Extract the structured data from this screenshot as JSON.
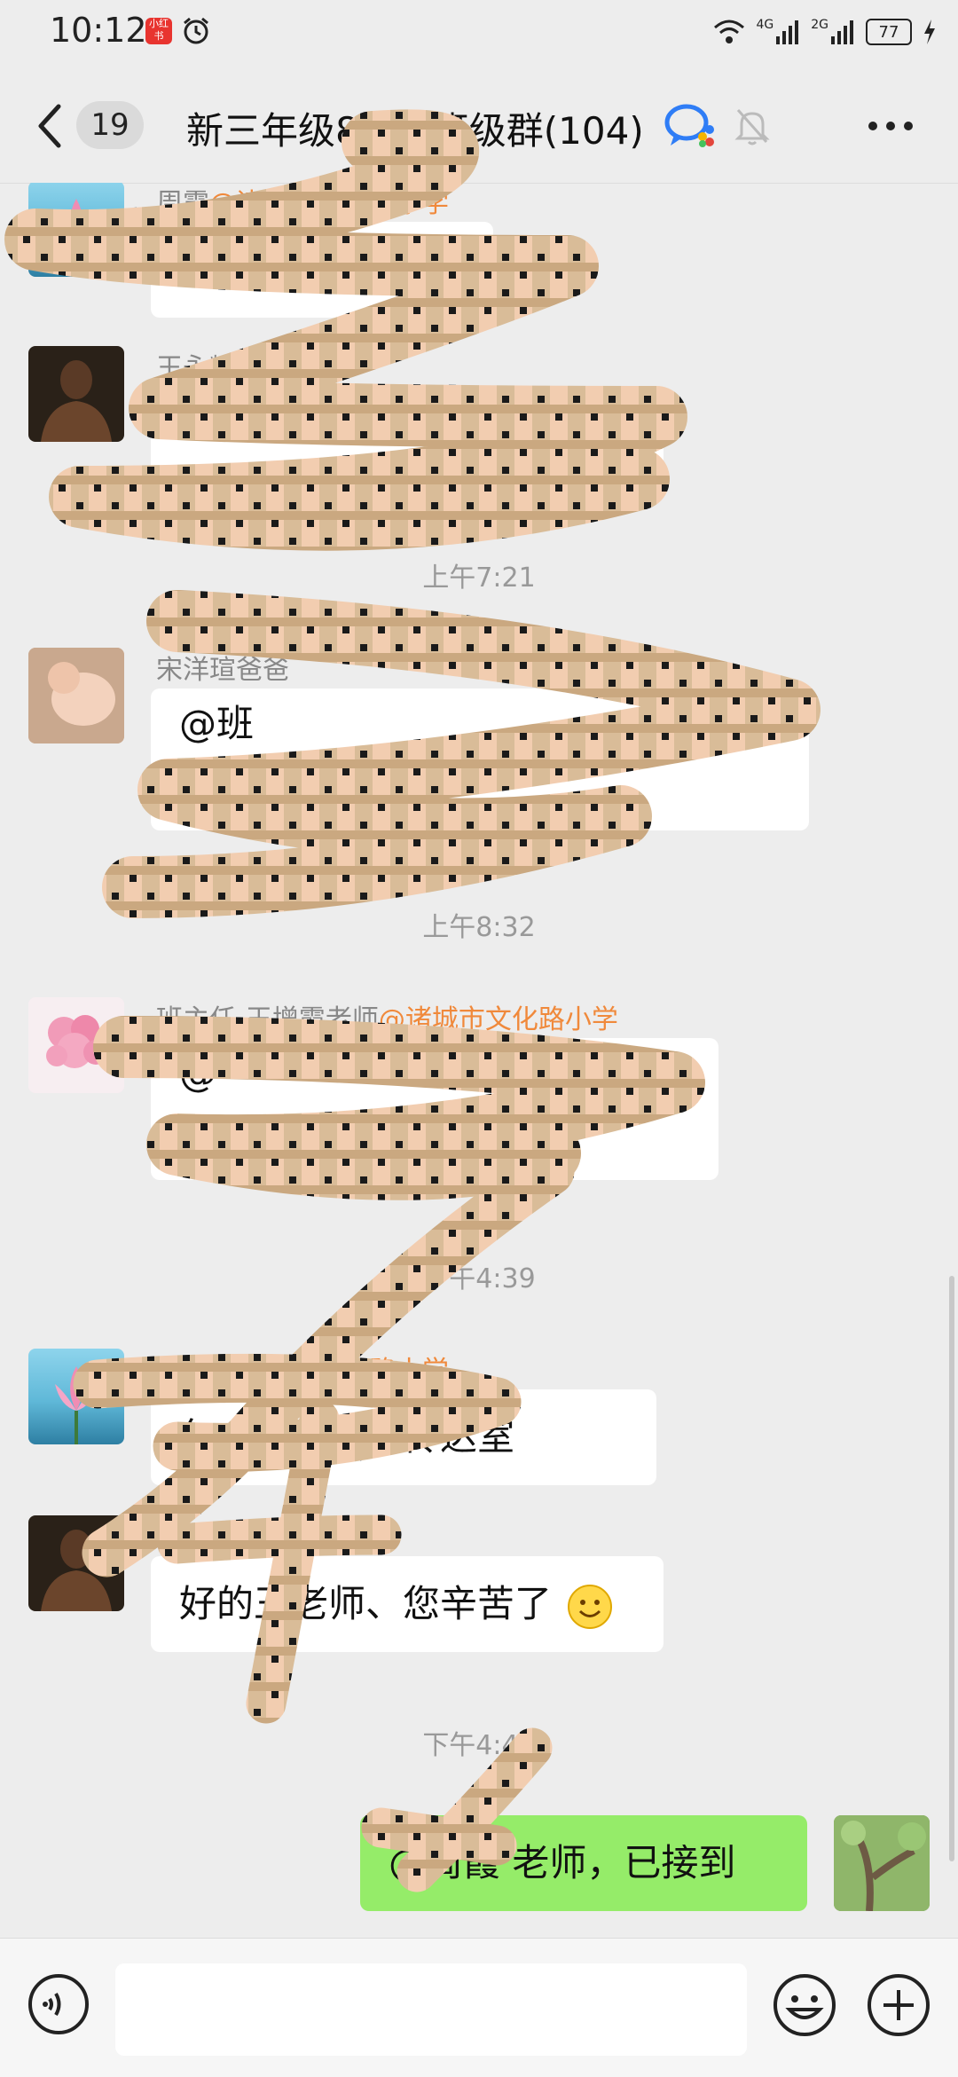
{
  "status_bar": {
    "time": "10:12",
    "app_badge_text": "小红书",
    "network_1": "4G",
    "network_2": "2G",
    "battery": "77"
  },
  "nav": {
    "unread_count": "19",
    "title": "新三年级8班 · 班级群(104)"
  },
  "messages": {
    "m1": {
      "name": "周霞",
      "org": "@诸城市文化路小学",
      "text": "上一旗"
    },
    "m2": {
      "name": "王永辉",
      "text": ""
    },
    "ts1": "上午7:21",
    "m3": {
      "name": "宋洋瑄爸爸",
      "text": "@班"
    },
    "ts2": "上午8:32",
    "m4": {
      "name": "班主任-王增霞老师",
      "org": "@诸城市文化路小学",
      "text": "@"
    },
    "ts3": "下午4:39",
    "m5": {
      "name": "周霞",
      "org": "@诸城市文化路小学",
      "text": "包小朋友的在传达室"
    },
    "m6": {
      "name": "王永辉",
      "text": "好的王老师、您辛苦了",
      "emoji": "smile-emoji"
    },
    "ts4": "下午4:48",
    "m7": {
      "text": "@周霞 老师，已接到"
    }
  },
  "input": {
    "placeholder": ""
  },
  "colors": {
    "accent_green": "#95ec69",
    "org_orange": "#f0893b",
    "background": "#ededed"
  }
}
